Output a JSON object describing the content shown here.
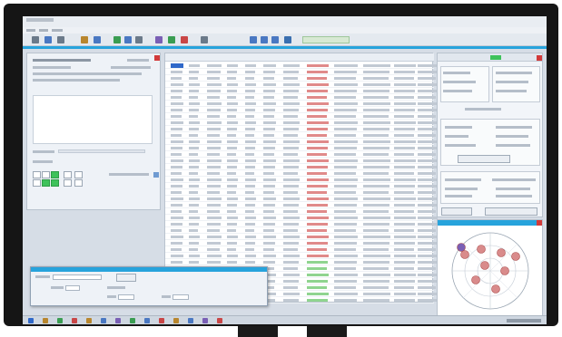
{
  "app": {
    "title": "",
    "menus": []
  },
  "icons": {
    "toolbar": [
      "folder-icon",
      "save-icon",
      "print-icon",
      "copy-icon",
      "paste-icon",
      "chart-icon",
      "table-icon",
      "grid-icon",
      "filter-icon",
      "play-icon",
      "stop-icon",
      "settings-icon",
      "search-icon",
      "zoom-in-icon",
      "zoom-out-icon",
      "help-icon"
    ],
    "taskbar": [
      "start-icon",
      "explorer-icon",
      "browser-icon",
      "mail-icon",
      "folder-icon",
      "terminal-icon",
      "app-icon",
      "app-icon",
      "app-icon",
      "app-icon",
      "app-icon",
      "app-icon",
      "app-icon",
      "app-icon"
    ]
  },
  "colors": {
    "accent": "#27a3dc",
    "highlight_green": "#3ec25a",
    "alert_red": "#d23a3a",
    "selection_blue": "#2f68c9"
  },
  "table": {
    "columns": 11,
    "rows": 38,
    "selected_row": 0
  },
  "polar_plot": {
    "markers": 9
  },
  "text_legible": false
}
